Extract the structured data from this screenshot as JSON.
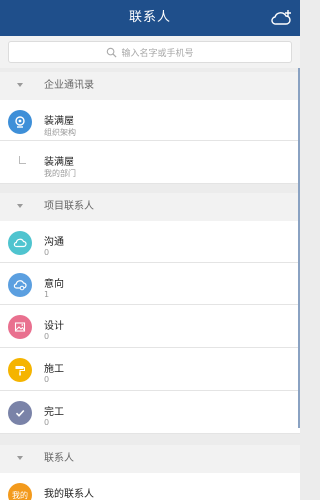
{
  "header": {
    "title": "联系人",
    "cloud_icon": "cloud-add-icon"
  },
  "search": {
    "placeholder": "输入名字或手机号",
    "icon": "search-icon"
  },
  "sections": [
    {
      "title": "企业通讯录",
      "items": [
        {
          "name": "装满屋",
          "sub": "组织架构",
          "icon": "org-structure-icon",
          "color": "#3e8fd8"
        },
        {
          "name": "装满屋",
          "sub": "我的部门",
          "icon": "corner-indent-icon"
        }
      ]
    },
    {
      "title": "项目联系人",
      "items": [
        {
          "name": "沟通",
          "sub": "0",
          "icon": "cloud-icon",
          "color": "#4fc4cf"
        },
        {
          "name": "意向",
          "sub": "1",
          "icon": "cloud-link-icon",
          "color": "#5b9fe0"
        },
        {
          "name": "设计",
          "sub": "0",
          "icon": "image-icon",
          "color": "#e9708f"
        },
        {
          "name": "施工",
          "sub": "0",
          "icon": "paint-roller-icon",
          "color": "#f5b400"
        },
        {
          "name": "完工",
          "sub": "0",
          "icon": "check-icon",
          "color": "#7a83a8"
        }
      ]
    },
    {
      "title": "联系人",
      "items": [
        {
          "name": "我的联系人",
          "sub": "",
          "avatar_text": "我的",
          "color": "#f39a1c"
        }
      ]
    }
  ],
  "colors": {
    "header": "#1f4f8b",
    "background": "#ececec",
    "accent": "#3e8fd8"
  }
}
